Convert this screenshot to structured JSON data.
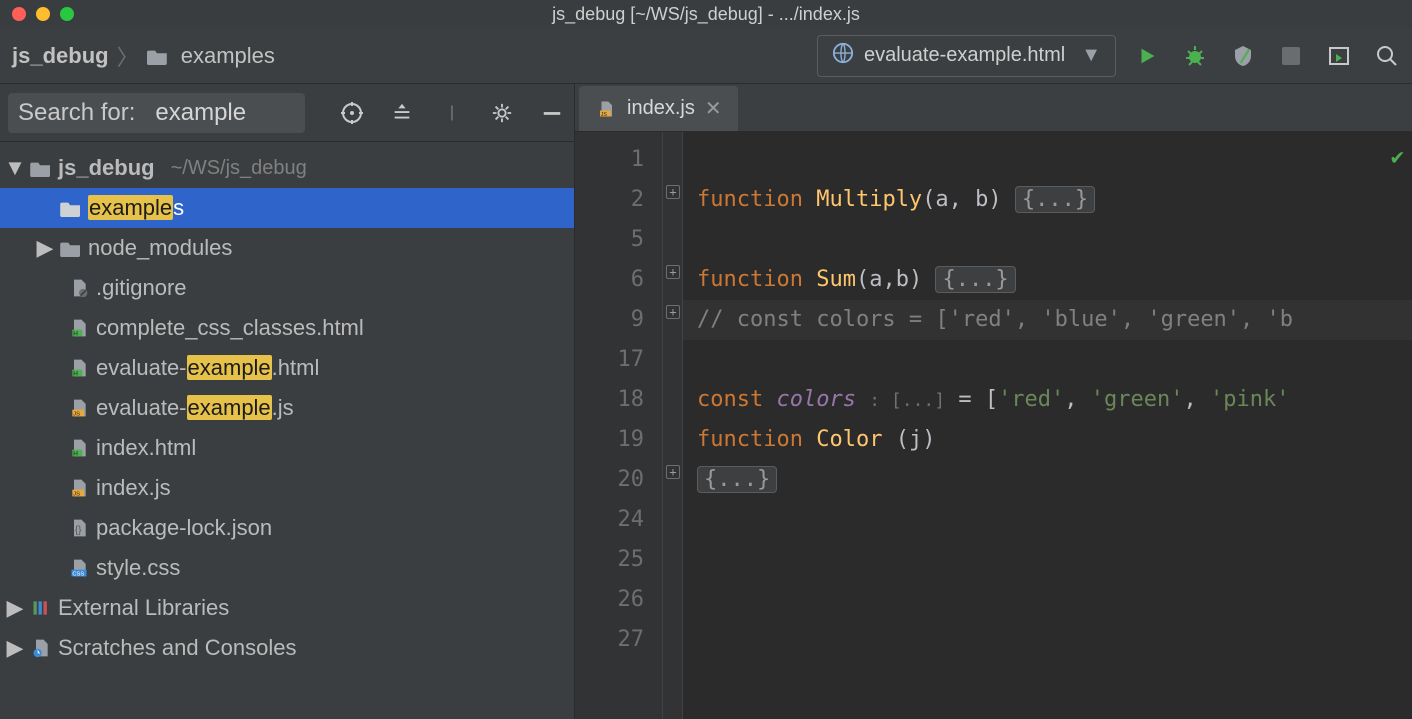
{
  "window_title": "js_debug [~/WS/js_debug] - .../index.js",
  "breadcrumbs": {
    "project": "js_debug",
    "folder": "examples"
  },
  "run_config": {
    "label": "evaluate-example.html"
  },
  "search": {
    "label": "Search for:",
    "value": "example"
  },
  "tree": {
    "root": {
      "name": "js_debug",
      "path": "~/WS/js_debug"
    },
    "examples": {
      "pre": "example",
      "post": "s"
    },
    "node_modules": "node_modules",
    "gitignore": ".gitignore",
    "complete_css": "complete_css_classes.html",
    "eval_html": {
      "pre": "evaluate-",
      "hl": "example",
      "post": ".html"
    },
    "eval_js": {
      "pre": "evaluate-",
      "hl": "example",
      "post": ".js"
    },
    "index_html": "index.html",
    "index_js": "index.js",
    "pkg_lock": "package-lock.json",
    "style_css": "style.css",
    "ext_lib": "External Libraries",
    "scratches": "Scratches and Consoles"
  },
  "tab": {
    "name": "index.js"
  },
  "gutter_lines": [
    "1",
    "2",
    "5",
    "6",
    "9",
    "17",
    "18",
    "19",
    "20",
    "24",
    "25",
    "26",
    "27"
  ],
  "code": {
    "l2": {
      "kw": "function",
      "fn": "Multiply",
      "args": "(a, b)",
      "fold": "{...}"
    },
    "l6": {
      "kw": "function",
      "fn": "Sum",
      "args": "(a,b)",
      "fold": "{...}"
    },
    "l9": "// const colors = ['red', 'blue', 'green', 'b",
    "l18": {
      "kw": "const",
      "name": "colors",
      "hint": ": [...]",
      "eq": " = [",
      "s1": "'red'",
      "c1": ",  ",
      "s2": "'green'",
      "c2": ", ",
      "s3": "'pink'"
    },
    "l19": {
      "kw": "function",
      "fn": "Color",
      "args": " (j)"
    },
    "l20": "{...}"
  }
}
